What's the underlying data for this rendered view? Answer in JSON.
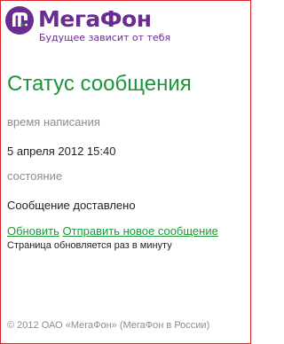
{
  "brand": {
    "name": "МегаФон",
    "slogan": "Будущее зависит от тебя",
    "colors": {
      "purple": "#6b2c91",
      "green": "#1d9638"
    }
  },
  "page": {
    "title": "Статус сообщения"
  },
  "fields": {
    "written_label": "время написания",
    "written_value": "5 апреля 2012 15:40",
    "status_label": "состояние",
    "status_value": "Сообщение доставлено"
  },
  "actions": {
    "refresh_label": "Обновить",
    "new_message_label": "Отправить новое сообщение"
  },
  "note": "Страница обновляется раз в минуту",
  "footer": "© 2012 ОАО «МегаФон» (МегаФон в России)"
}
